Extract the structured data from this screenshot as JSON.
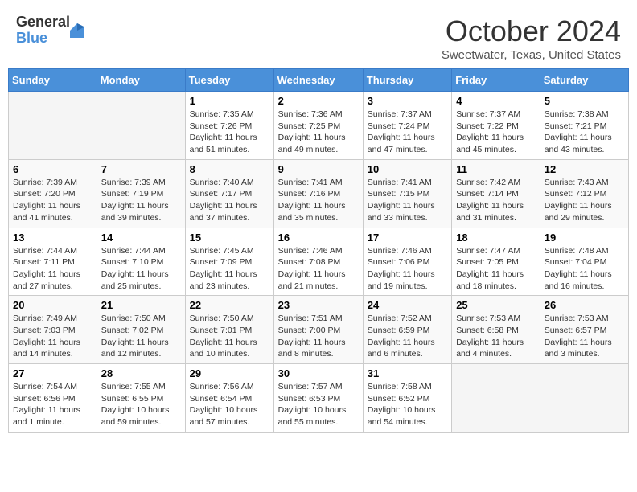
{
  "header": {
    "logo_general": "General",
    "logo_blue": "Blue",
    "month_title": "October 2024",
    "location": "Sweetwater, Texas, United States"
  },
  "calendar": {
    "days_of_week": [
      "Sunday",
      "Monday",
      "Tuesday",
      "Wednesday",
      "Thursday",
      "Friday",
      "Saturday"
    ],
    "weeks": [
      [
        {
          "day": "",
          "info": ""
        },
        {
          "day": "",
          "info": ""
        },
        {
          "day": "1",
          "info": "Sunrise: 7:35 AM\nSunset: 7:26 PM\nDaylight: 11 hours and 51 minutes."
        },
        {
          "day": "2",
          "info": "Sunrise: 7:36 AM\nSunset: 7:25 PM\nDaylight: 11 hours and 49 minutes."
        },
        {
          "day": "3",
          "info": "Sunrise: 7:37 AM\nSunset: 7:24 PM\nDaylight: 11 hours and 47 minutes."
        },
        {
          "day": "4",
          "info": "Sunrise: 7:37 AM\nSunset: 7:22 PM\nDaylight: 11 hours and 45 minutes."
        },
        {
          "day": "5",
          "info": "Sunrise: 7:38 AM\nSunset: 7:21 PM\nDaylight: 11 hours and 43 minutes."
        }
      ],
      [
        {
          "day": "6",
          "info": "Sunrise: 7:39 AM\nSunset: 7:20 PM\nDaylight: 11 hours and 41 minutes."
        },
        {
          "day": "7",
          "info": "Sunrise: 7:39 AM\nSunset: 7:19 PM\nDaylight: 11 hours and 39 minutes."
        },
        {
          "day": "8",
          "info": "Sunrise: 7:40 AM\nSunset: 7:17 PM\nDaylight: 11 hours and 37 minutes."
        },
        {
          "day": "9",
          "info": "Sunrise: 7:41 AM\nSunset: 7:16 PM\nDaylight: 11 hours and 35 minutes."
        },
        {
          "day": "10",
          "info": "Sunrise: 7:41 AM\nSunset: 7:15 PM\nDaylight: 11 hours and 33 minutes."
        },
        {
          "day": "11",
          "info": "Sunrise: 7:42 AM\nSunset: 7:14 PM\nDaylight: 11 hours and 31 minutes."
        },
        {
          "day": "12",
          "info": "Sunrise: 7:43 AM\nSunset: 7:12 PM\nDaylight: 11 hours and 29 minutes."
        }
      ],
      [
        {
          "day": "13",
          "info": "Sunrise: 7:44 AM\nSunset: 7:11 PM\nDaylight: 11 hours and 27 minutes."
        },
        {
          "day": "14",
          "info": "Sunrise: 7:44 AM\nSunset: 7:10 PM\nDaylight: 11 hours and 25 minutes."
        },
        {
          "day": "15",
          "info": "Sunrise: 7:45 AM\nSunset: 7:09 PM\nDaylight: 11 hours and 23 minutes."
        },
        {
          "day": "16",
          "info": "Sunrise: 7:46 AM\nSunset: 7:08 PM\nDaylight: 11 hours and 21 minutes."
        },
        {
          "day": "17",
          "info": "Sunrise: 7:46 AM\nSunset: 7:06 PM\nDaylight: 11 hours and 19 minutes."
        },
        {
          "day": "18",
          "info": "Sunrise: 7:47 AM\nSunset: 7:05 PM\nDaylight: 11 hours and 18 minutes."
        },
        {
          "day": "19",
          "info": "Sunrise: 7:48 AM\nSunset: 7:04 PM\nDaylight: 11 hours and 16 minutes."
        }
      ],
      [
        {
          "day": "20",
          "info": "Sunrise: 7:49 AM\nSunset: 7:03 PM\nDaylight: 11 hours and 14 minutes."
        },
        {
          "day": "21",
          "info": "Sunrise: 7:50 AM\nSunset: 7:02 PM\nDaylight: 11 hours and 12 minutes."
        },
        {
          "day": "22",
          "info": "Sunrise: 7:50 AM\nSunset: 7:01 PM\nDaylight: 11 hours and 10 minutes."
        },
        {
          "day": "23",
          "info": "Sunrise: 7:51 AM\nSunset: 7:00 PM\nDaylight: 11 hours and 8 minutes."
        },
        {
          "day": "24",
          "info": "Sunrise: 7:52 AM\nSunset: 6:59 PM\nDaylight: 11 hours and 6 minutes."
        },
        {
          "day": "25",
          "info": "Sunrise: 7:53 AM\nSunset: 6:58 PM\nDaylight: 11 hours and 4 minutes."
        },
        {
          "day": "26",
          "info": "Sunrise: 7:53 AM\nSunset: 6:57 PM\nDaylight: 11 hours and 3 minutes."
        }
      ],
      [
        {
          "day": "27",
          "info": "Sunrise: 7:54 AM\nSunset: 6:56 PM\nDaylight: 11 hours and 1 minute."
        },
        {
          "day": "28",
          "info": "Sunrise: 7:55 AM\nSunset: 6:55 PM\nDaylight: 10 hours and 59 minutes."
        },
        {
          "day": "29",
          "info": "Sunrise: 7:56 AM\nSunset: 6:54 PM\nDaylight: 10 hours and 57 minutes."
        },
        {
          "day": "30",
          "info": "Sunrise: 7:57 AM\nSunset: 6:53 PM\nDaylight: 10 hours and 55 minutes."
        },
        {
          "day": "31",
          "info": "Sunrise: 7:58 AM\nSunset: 6:52 PM\nDaylight: 10 hours and 54 minutes."
        },
        {
          "day": "",
          "info": ""
        },
        {
          "day": "",
          "info": ""
        }
      ]
    ]
  }
}
